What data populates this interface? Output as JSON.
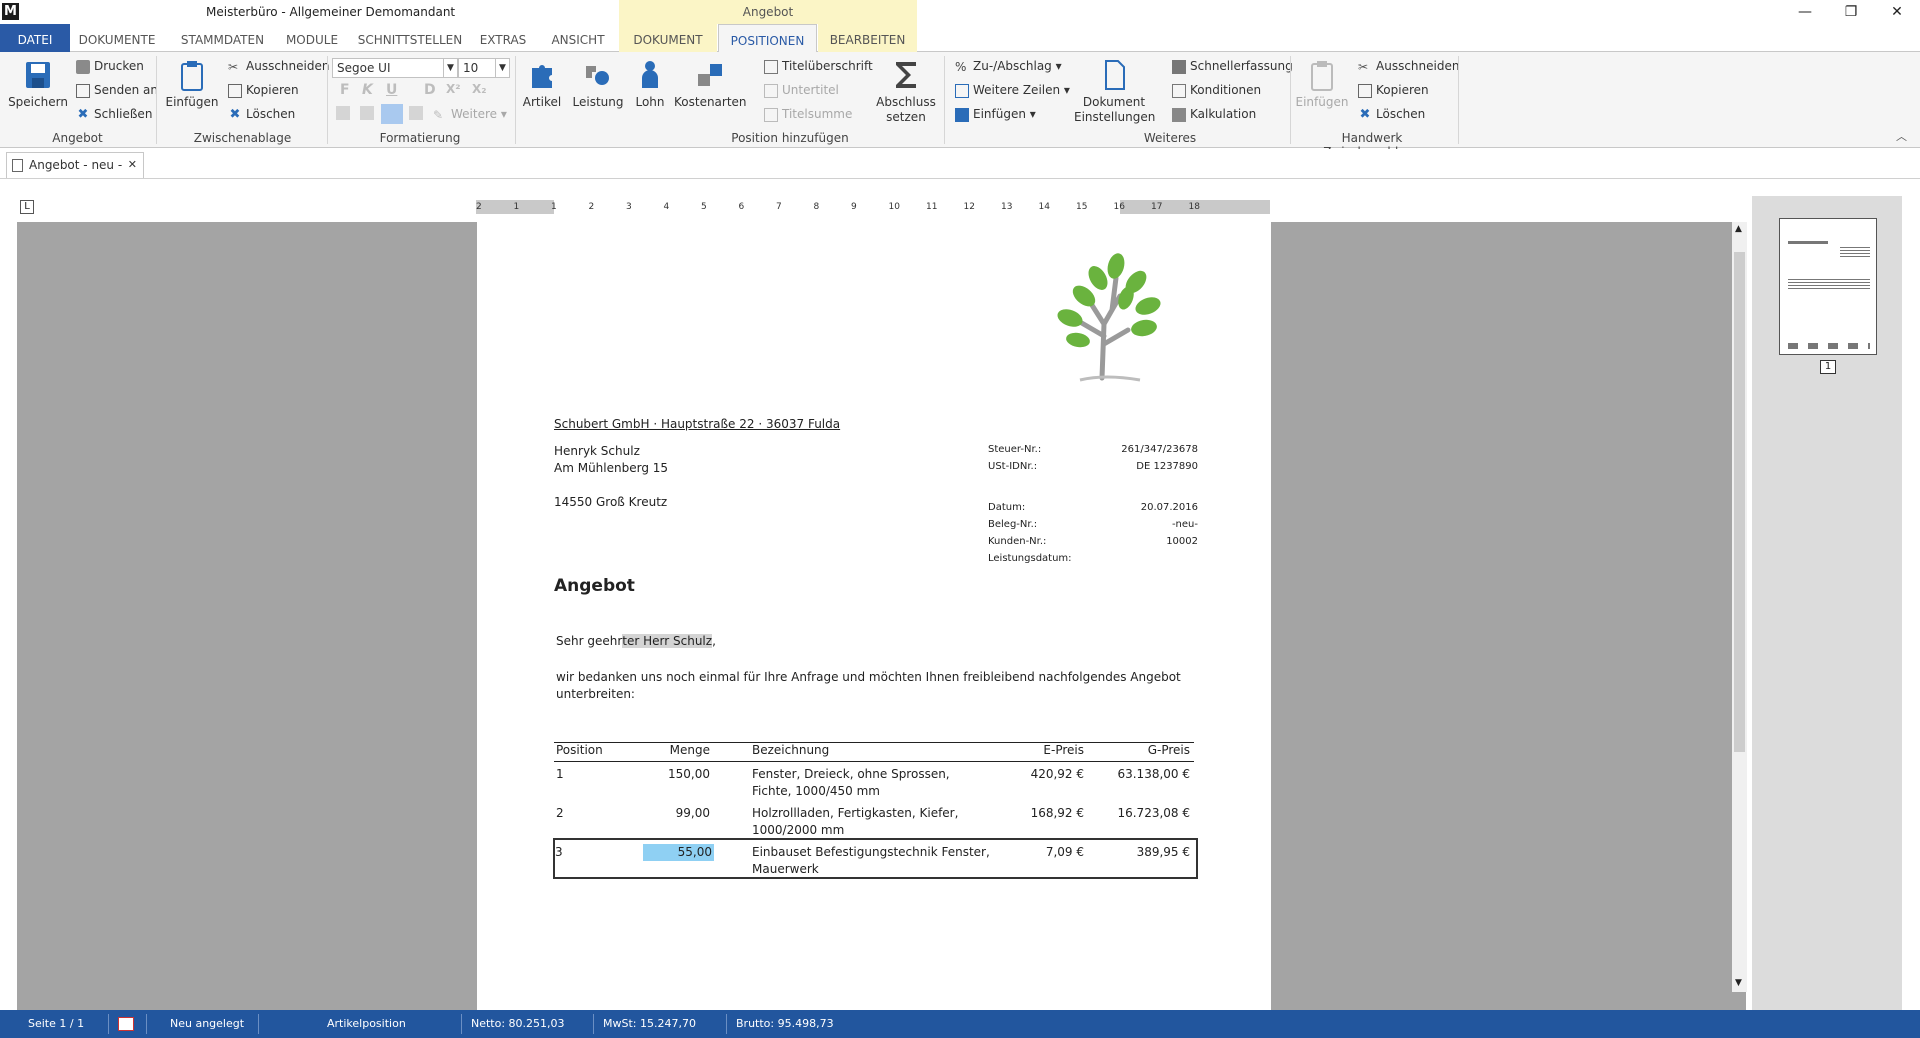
{
  "titlebar": {
    "logo": "M",
    "title": "Meisterbüro - Allgemeiner Demomandant",
    "context_label": "Angebot",
    "minimize": "—",
    "restore": "❐",
    "close": "✕"
  },
  "tabs": {
    "file": "DATEI",
    "items": [
      "DOKUMENTE",
      "STAMMDATEN",
      "MODULE",
      "SCHNITTSTELLEN",
      "EXTRAS",
      "ANSICHT"
    ],
    "ctx_dokument": "DOKUMENT",
    "ctx_positionen": "POSITIONEN",
    "ctx_bearbeiten": "BEARBEITEN"
  },
  "ribbon": {
    "angebot": {
      "label": "Angebot",
      "save": "Speichern",
      "print": "Drucken",
      "send": "Senden an",
      "close": "Schließen"
    },
    "clipboard": {
      "label": "Zwischenablage",
      "paste": "Einfügen",
      "cut": "Ausschneiden",
      "copy": "Kopieren",
      "delete": "Löschen"
    },
    "format": {
      "label": "Formatierung",
      "font": "Segoe UI",
      "size": "10",
      "more": "Weitere",
      "bold": "F",
      "italic": "K",
      "underline": "U",
      "strike": "D",
      "sup": "X²",
      "sub": "X₂"
    },
    "add_position": {
      "label": "Position hinzufügen",
      "article": "Artikel",
      "service": "Leistung",
      "wage": "Lohn",
      "cost_types": "Kostenarten",
      "title_heading": "Titelüberschrift",
      "subtitle": "Untertitel",
      "title_sum": "Titelsumme",
      "closing_line1": "Abschluss",
      "closing_line2": "setzen"
    },
    "more": {
      "label": "Weiteres",
      "surcharge": "Zu-/Abschlag",
      "more_rows": "Weitere Zeilen",
      "insert": "Einfügen",
      "doc_settings_line1": "Dokument",
      "doc_settings_line2": "Einstellungen",
      "quick_entry": "Schnellerfassung",
      "conditions": "Konditionen",
      "calculation": "Kalkulation"
    },
    "hw_clipboard": {
      "label": "Handwerk Zwischenablage",
      "paste": "Einfügen",
      "cut": "Ausschneiden",
      "copy": "Kopieren",
      "delete": "Löschen"
    }
  },
  "doc_tab": {
    "title": "Angebot - neu -",
    "close": "✕"
  },
  "ruler": {
    "corner": "L",
    "ticks": [
      "2",
      "1",
      "1",
      "2",
      "3",
      "4",
      "5",
      "6",
      "7",
      "8",
      "9",
      "10",
      "11",
      "12",
      "13",
      "14",
      "15",
      "16",
      "17",
      "18"
    ]
  },
  "document": {
    "sender": "Schubert GmbH · Hauptstraße 22 · 36037 Fulda",
    "recipient_name": "Henryk Schulz",
    "recipient_street": "Am Mühlenberg 15",
    "recipient_city": "14550 Groß Kreutz",
    "meta": [
      {
        "k": "Steuer-Nr.:",
        "v": "261/347/23678"
      },
      {
        "k": "USt-IDNr.:",
        "v": "DE 1237890"
      },
      {
        "k": "Datum:",
        "v": "20.07.2016"
      },
      {
        "k": "Beleg-Nr.:",
        "v": "-neu-"
      },
      {
        "k": "Kunden-Nr.:",
        "v": "10002"
      },
      {
        "k": "Leistungsdatum:",
        "v": ""
      }
    ],
    "title": "Angebot",
    "salutation_pre": "Sehr geehr",
    "salutation_hl": "ter Herr Schulz",
    "salutation_post": ",",
    "intro": "wir bedanken uns noch einmal für Ihre Anfrage und möchten Ihnen freibleibend nachfolgendes Angebot unterbreiten:",
    "table_headers": {
      "position": "Position",
      "qty": "Menge",
      "desc": "Bezeichnung",
      "unit_price": "E-Preis",
      "total_price": "G-Preis"
    },
    "rows": [
      {
        "pos": "1",
        "qty": "150,00",
        "desc": "Fenster, Dreieck, ohne Sprossen, Fichte, 1000/450 mm",
        "unit": "420,92 €",
        "total": "63.138,00 €"
      },
      {
        "pos": "2",
        "qty": "99,00",
        "desc": "Holzrollladen, Fertigkasten, Kiefer, 1000/2000 mm",
        "unit": "168,92 €",
        "total": "16.723,08 €"
      },
      {
        "pos": "3",
        "qty": "55,00",
        "desc": "Einbauset Befestigungstechnik Fenster, Mauerwerk",
        "unit": "7,09 €",
        "total": "389,95 €"
      }
    ]
  },
  "thumbnail": {
    "page_number": "1"
  },
  "status": {
    "page": "Seite 1 / 1",
    "state": "Neu angelegt",
    "context": "Artikelposition",
    "net": "Netto: 80.251,03",
    "vat": "MwSt: 15.247,70",
    "gross": "Brutto: 95.498,73"
  },
  "colors": {
    "accent": "#2a5aa6",
    "status_bar": "#22569e",
    "context_tab": "#fbf5c6",
    "leaf_green": "#6ab33e"
  }
}
